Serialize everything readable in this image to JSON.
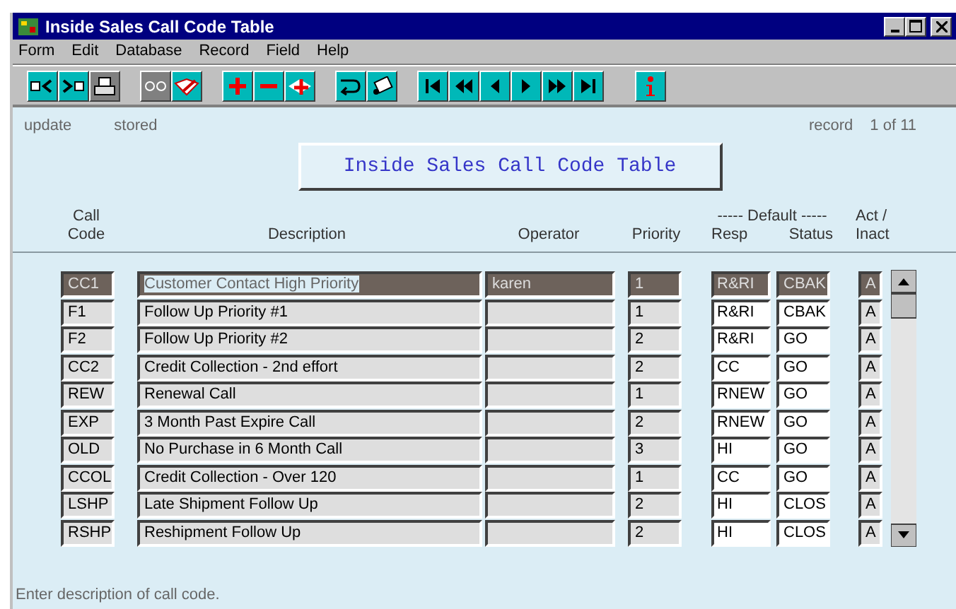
{
  "window": {
    "title": "Inside Sales Call Code Table"
  },
  "menu": [
    "Form",
    "Edit",
    "Database",
    "Record",
    "Field",
    "Help"
  ],
  "mode": {
    "action": "update",
    "state": "stored",
    "record_label": "record",
    "record_position": "1 of 11"
  },
  "form_title": "Inside Sales Call Code Table",
  "columns": {
    "call_code": [
      "Call",
      "Code"
    ],
    "description": "Description",
    "operator": "Operator",
    "priority": "Priority",
    "default_group": "----- Default -----",
    "resp": "Resp",
    "status": "Status",
    "active": [
      "Act /",
      "Inact"
    ]
  },
  "rows": [
    {
      "code": "CC1",
      "description": "Customer Contact High Priority",
      "operator": "karen",
      "priority": "1",
      "resp": "R&RI",
      "status": "CBAK",
      "active": "A",
      "selected": true
    },
    {
      "code": "F1",
      "description": "Follow Up Priority #1",
      "priority": "1",
      "resp": "R&RI",
      "status": "CBAK",
      "active": "A",
      "selected": false
    },
    {
      "code": "F2",
      "description": "Follow Up Priority #2",
      "priority": "2",
      "resp": "R&RI",
      "status": "GO",
      "active": "A",
      "selected": false
    },
    {
      "code": "CC2",
      "description": "Credit Collection - 2nd effort",
      "priority": "2",
      "resp": "CC",
      "status": "GO",
      "active": "A",
      "selected": false
    },
    {
      "code": "REW",
      "description": "Renewal Call",
      "priority": "1",
      "resp": "RNEW",
      "status": "GO",
      "active": "A",
      "selected": false
    },
    {
      "code": "EXP",
      "description": "3 Month Past Expire Call",
      "priority": "2",
      "resp": "RNEW",
      "status": "GO",
      "active": "A",
      "selected": false
    },
    {
      "code": "OLD",
      "description": "No Purchase in 6 Month Call",
      "priority": "3",
      "resp": "HI",
      "status": "GO",
      "active": "A",
      "selected": false
    },
    {
      "code": "CCOL",
      "description": "Credit Collection - Over 120",
      "priority": "1",
      "resp": "CC",
      "status": "GO",
      "active": "A",
      "selected": false
    },
    {
      "code": "LSHP",
      "description": "Late Shipment Follow Up",
      "priority": "2",
      "resp": "HI",
      "status": "CLOS",
      "active": "A",
      "selected": false
    },
    {
      "code": "RSHP",
      "description": "Reshipment Follow Up",
      "priority": "2",
      "resp": "HI",
      "status": "CLOS",
      "active": "A",
      "selected": false
    }
  ],
  "status_bar": "Enter description of call code."
}
